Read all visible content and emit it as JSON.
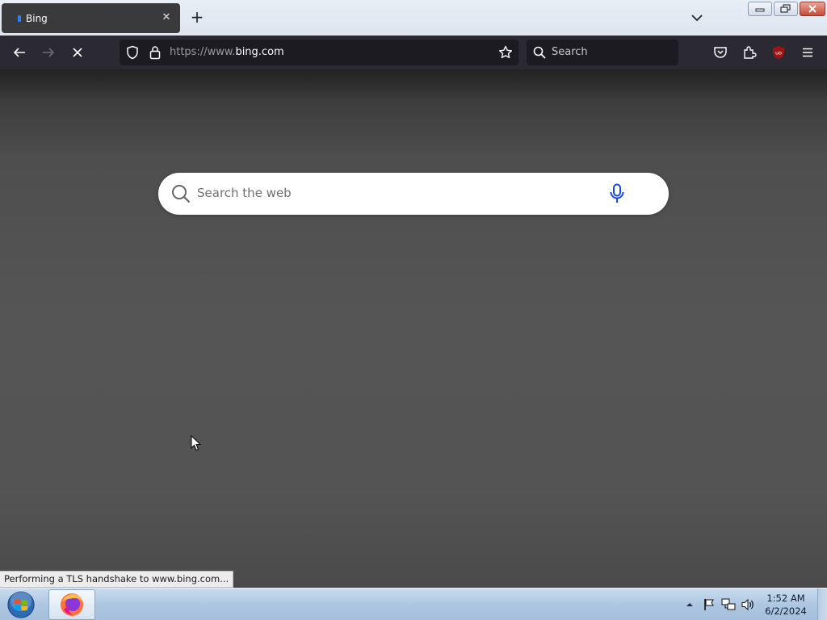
{
  "browser": {
    "tab": {
      "title": "Bing",
      "favicon": "bing-favicon",
      "close_glyph": "✕"
    },
    "new_tab_glyph": "+",
    "window_controls": [
      "minimize",
      "restore",
      "close"
    ]
  },
  "toolbar": {
    "url_scheme": "https://www.",
    "url_host": "bing.com",
    "search_placeholder": "Search",
    "icons": [
      "back-icon",
      "forward-icon",
      "stop-icon",
      "shield-icon",
      "lock-icon",
      "star-icon",
      "search-icon",
      "pocket-icon",
      "extensions-icon",
      "ublock-icon",
      "menu-icon"
    ],
    "ublock_badge": "uo"
  },
  "page": {
    "search_placeholder": "Search the web",
    "accent_color": "#174ae4"
  },
  "status_bar": {
    "text": "Performing a TLS handshake to www.bing.com..."
  },
  "taskbar": {
    "clock_time": "1:52 AM",
    "clock_date": "6/2/2024",
    "pinned": [
      "firefox-icon"
    ],
    "tray_icons": [
      "show-hidden-icons",
      "action-center-flag-icon",
      "network-icon",
      "volume-icon"
    ]
  }
}
